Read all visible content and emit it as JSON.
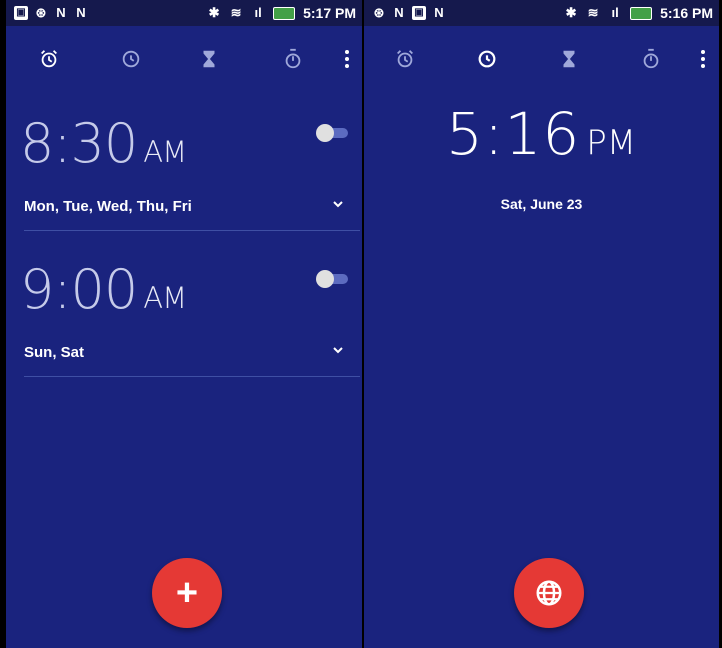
{
  "left": {
    "status": {
      "time": "5:17 PM",
      "left_icons": [
        "image-icon",
        "clock-status-icon",
        "n-icon",
        "n-icon"
      ],
      "right_icons": [
        "bluetooth-icon",
        "wifi-icon",
        "signal-icon",
        "battery-icon"
      ]
    },
    "tabs": [
      "alarm-tab",
      "clock-tab",
      "timer-tab",
      "stopwatch-tab"
    ],
    "alarms": [
      {
        "time": "8:30",
        "ampm": "AM",
        "days": "Mon, Tue, Wed, Thu, Fri",
        "enabled": false
      },
      {
        "time": "9:00",
        "ampm": "AM",
        "days": "Sun, Sat",
        "enabled": false
      }
    ],
    "fab_symbol": "+"
  },
  "right": {
    "status": {
      "time": "5:16 PM"
    },
    "clock": {
      "time": "5:16",
      "ampm": "PM",
      "date": "Sat, June 23"
    }
  },
  "colors": {
    "background": "#1a237e",
    "accent": "#e53935"
  }
}
